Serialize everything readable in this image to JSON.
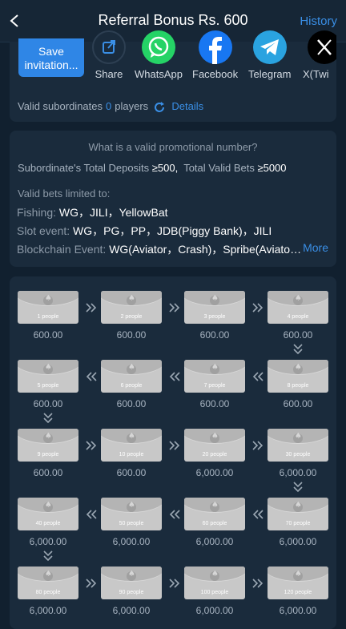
{
  "header": {
    "title": "Referral Bonus Rs. 600",
    "history": "History"
  },
  "share": {
    "save_label": "Save invitation...",
    "items": [
      {
        "label": "Share",
        "icon": "share-icon"
      },
      {
        "label": "WhatsApp",
        "icon": "whatsapp-icon"
      },
      {
        "label": "Facebook",
        "icon": "facebook-icon"
      },
      {
        "label": "Telegram",
        "icon": "telegram-icon"
      },
      {
        "label": "X(Twi",
        "icon": "x-icon"
      }
    ],
    "valid_label": "Valid subordinates",
    "valid_count": "0",
    "valid_unit": "players",
    "details": "Details"
  },
  "rules": {
    "question": "What is a valid promotional number?",
    "deposit_label": "Subordinate's Total Deposits",
    "deposit_value": "≥500,",
    "bets_label": "Total Valid Bets",
    "bets_value": "≥5000",
    "limited": "Valid bets limited to:",
    "fishing_label": "Fishing:",
    "fishing_value": "WG，JILI，YellowBat",
    "slot_label": "Slot event:",
    "slot_value": "WG，PG，PP，JDB(Piggy Bank)，JILI",
    "chain_label": "Blockchain Event:",
    "chain_value": "WG(Aviator，Crash)，Spribe(Aviato…",
    "more": "More"
  },
  "rewards": [
    {
      "people": "1 people",
      "amount": "600.00"
    },
    {
      "people": "2 people",
      "amount": "600.00"
    },
    {
      "people": "3 people",
      "amount": "600.00"
    },
    {
      "people": "4 people",
      "amount": "600.00"
    },
    {
      "people": "8 people",
      "amount": "600.00"
    },
    {
      "people": "7 people",
      "amount": "600.00"
    },
    {
      "people": "6 people",
      "amount": "600.00"
    },
    {
      "people": "5 people",
      "amount": "600.00"
    },
    {
      "people": "9 people",
      "amount": "600.00"
    },
    {
      "people": "10 people",
      "amount": "600.00"
    },
    {
      "people": "20 people",
      "amount": "6,000.00"
    },
    {
      "people": "30 people",
      "amount": "6,000.00"
    },
    {
      "people": "70 people",
      "amount": "6,000.00"
    },
    {
      "people": "60 people",
      "amount": "6,000.00"
    },
    {
      "people": "50 people",
      "amount": "6,000.00"
    },
    {
      "people": "40 people",
      "amount": "6,000.00"
    },
    {
      "people": "80 people",
      "amount": "6,000.00"
    },
    {
      "people": "90 people",
      "amount": "6,000.00"
    },
    {
      "people": "100 people",
      "amount": "6,000.00"
    },
    {
      "people": "120 people",
      "amount": "6,000.00"
    }
  ],
  "colors": {
    "accent": "#2f86e6",
    "background": "#11202f",
    "card": "#1a2b3c"
  }
}
